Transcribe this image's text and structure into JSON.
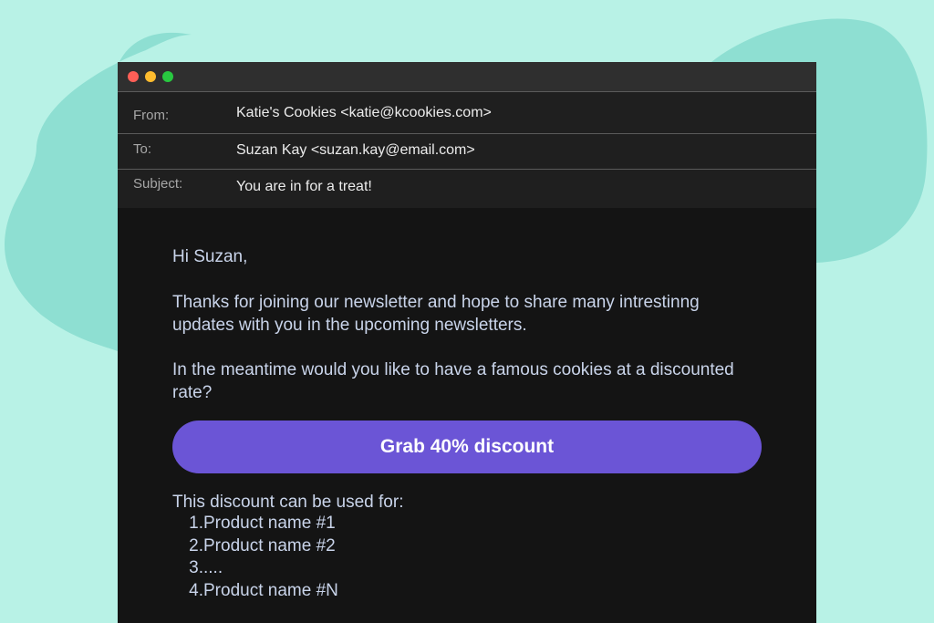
{
  "colors": {
    "page_background": "#b8f2e6",
    "blob": "#8edfd2",
    "window_background": "#141414",
    "titlebar": "#2f2f2f",
    "header_background": "#1f1f1f",
    "cta_background": "#6b55d6",
    "body_text": "#c9d4ea"
  },
  "window": {
    "controls": [
      {
        "name": "close",
        "color": "#fe5f57"
      },
      {
        "name": "minimize",
        "color": "#febc2e"
      },
      {
        "name": "maximize",
        "color": "#28c840"
      }
    ]
  },
  "email": {
    "from_label": "From:",
    "from_value": "Katie's Cookies <katie@kcookies.com>",
    "to_label": "To:",
    "to_value": "Suzan Kay <suzan.kay@email.com>",
    "subject_label": "Subject:",
    "subject_value": "You are in for a treat!",
    "greeting": "Hi Suzan,",
    "paragraph1": "Thanks for joining our newsletter and hope to share many intrestinng updates with you in the upcoming newsletters.",
    "paragraph2": "In the meantime would you like to have a famous cookies at a discounted rate?",
    "cta_label": "Grab 40% discount",
    "usage_intro": "This discount can be used for:",
    "list": [
      {
        "num": "1.",
        "text": "Product name #1"
      },
      {
        "num": "2.",
        "text": "Product name #2"
      },
      {
        "num": "3.",
        "text": "...."
      },
      {
        "num": "4.",
        "text": "Product name #N"
      }
    ]
  }
}
